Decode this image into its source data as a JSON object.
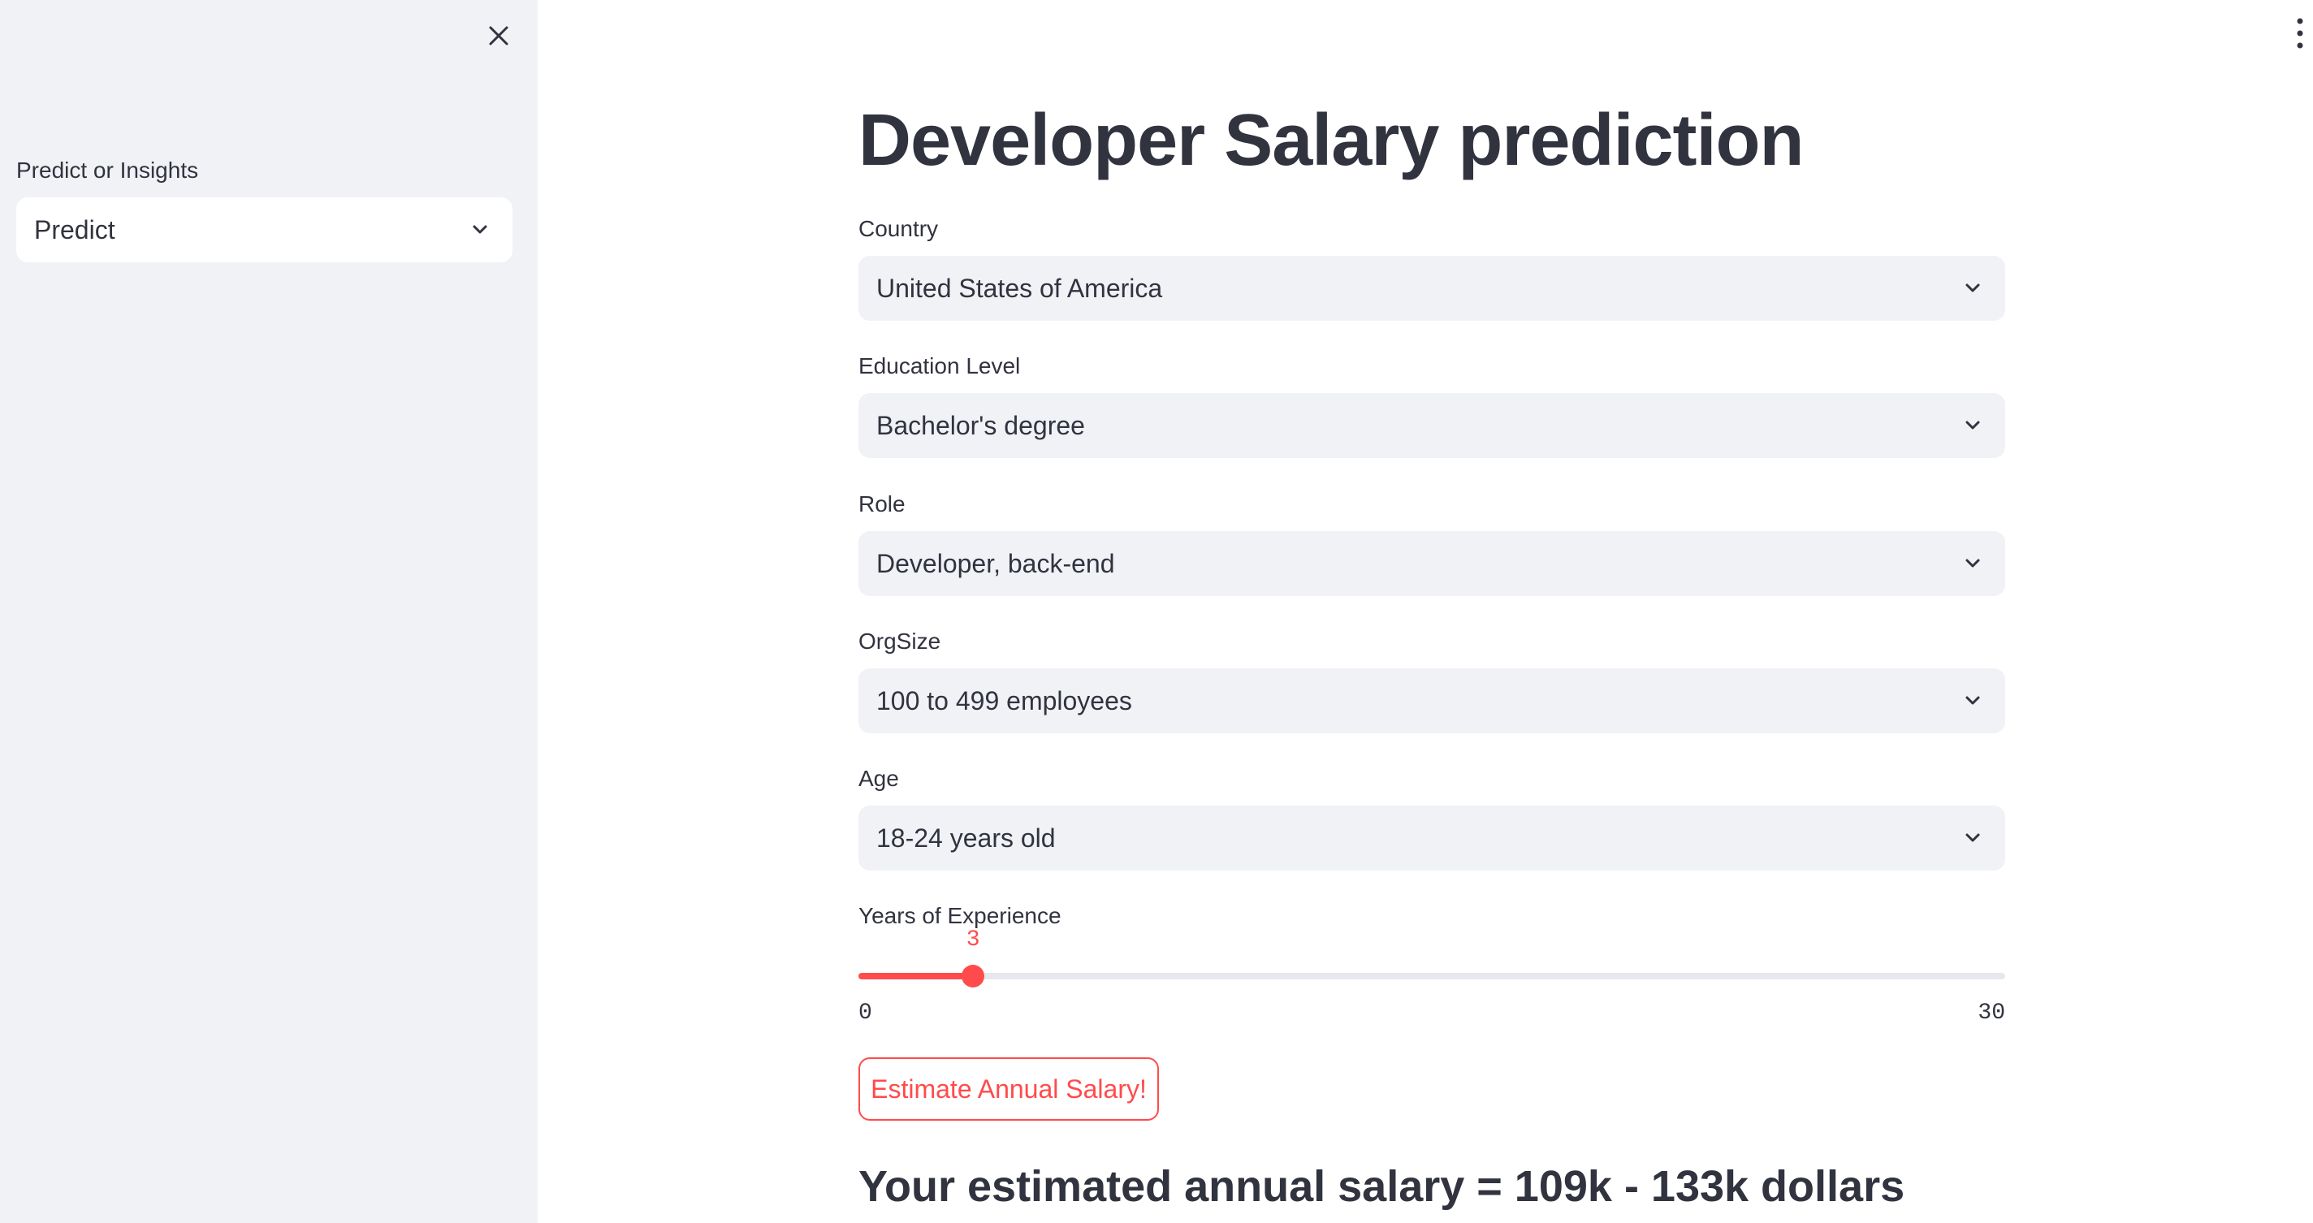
{
  "sidebar": {
    "close_icon": "close-icon",
    "select_label": "Predict or Insights",
    "select_value": "Predict"
  },
  "header": {
    "menu_icon": "more-vertical-icon"
  },
  "main": {
    "title": "Developer Salary prediction",
    "fields": [
      {
        "label": "Country",
        "value": "United States of America"
      },
      {
        "label": "Education Level",
        "value": "Bachelor's degree"
      },
      {
        "label": "Role",
        "value": "Developer, back-end"
      },
      {
        "label": "OrgSize",
        "value": "100 to 499 employees"
      },
      {
        "label": "Age",
        "value": "18-24 years old"
      }
    ],
    "slider": {
      "label": "Years of Experience",
      "value": 3,
      "value_text": "3",
      "min": 0,
      "max": 30,
      "min_text": "0",
      "max_text": "30"
    },
    "button_label": "Estimate Annual Salary!",
    "result_text": "Your estimated annual salary = 109k - 133k dollars"
  },
  "colors": {
    "accent": "#ff4b4b",
    "sidebar_bg": "#f0f2f6",
    "text": "#31333f"
  }
}
